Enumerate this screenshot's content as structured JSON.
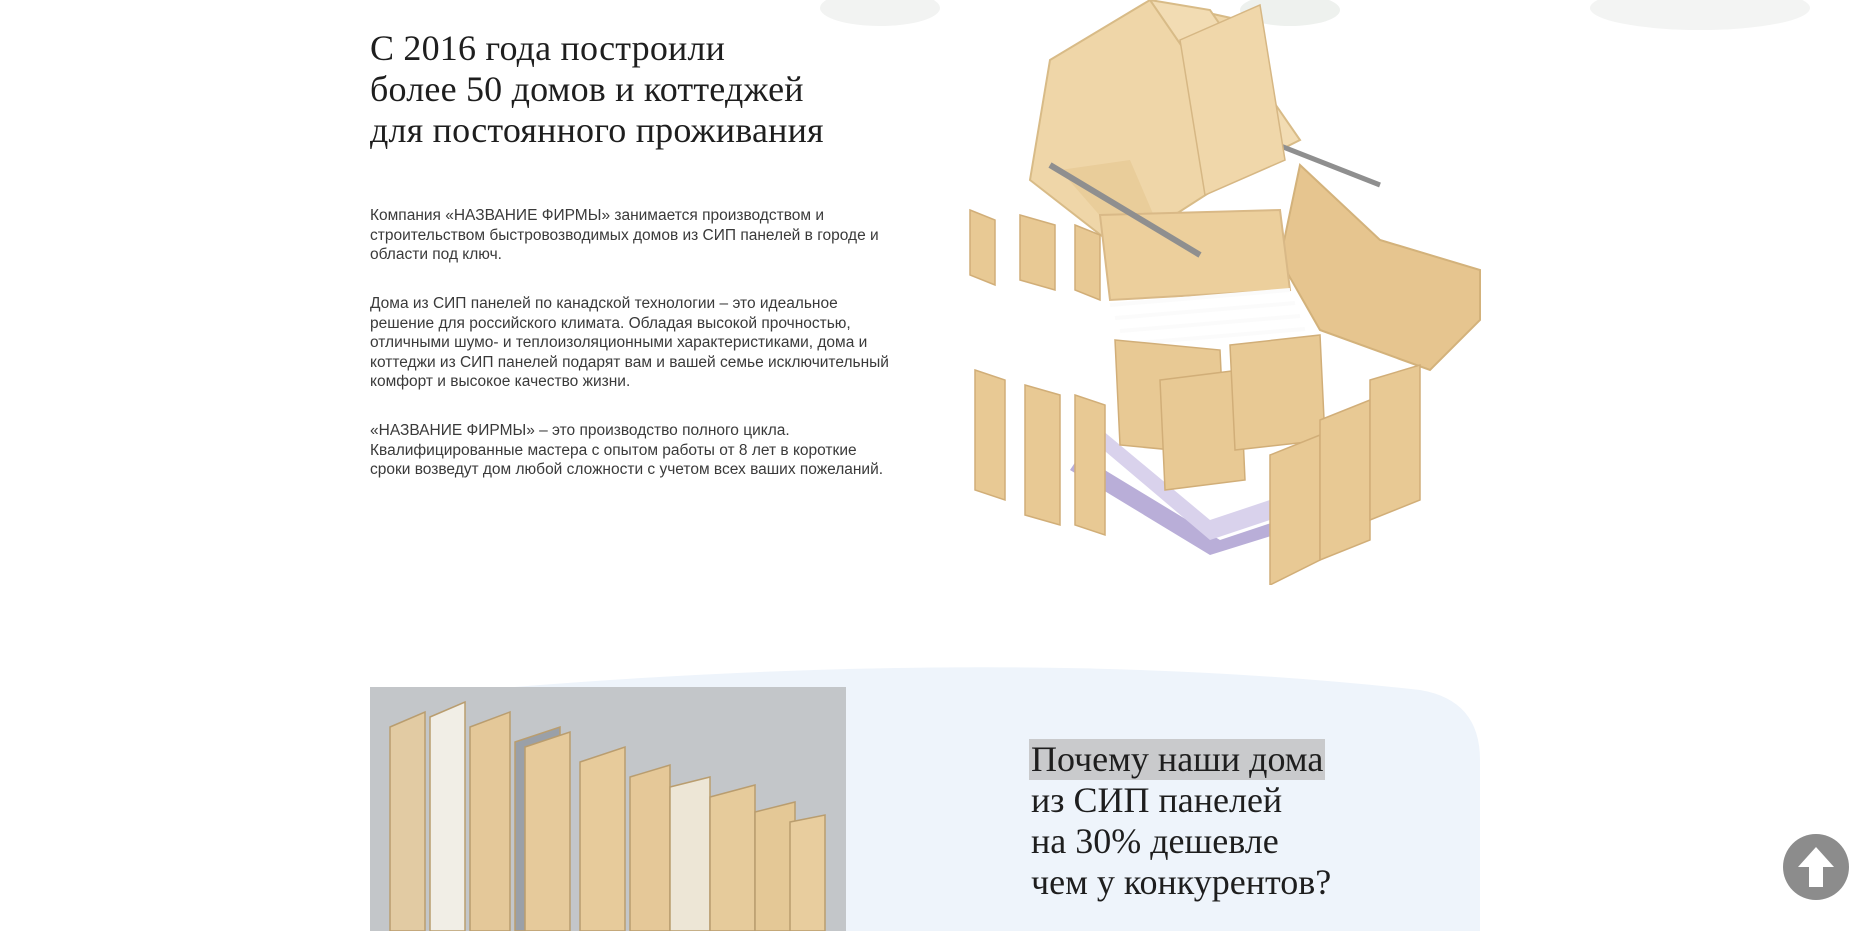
{
  "about": {
    "heading_lines": [
      "С 2016 года построили",
      "более 50 домов и коттеджей",
      "для постоянного проживания"
    ],
    "paragraph1": "Компания «НАЗВАНИЕ ФИРМЫ» занимается производством и строительством быстровозводимых домов из СИП панелей в городе и области под ключ.",
    "paragraph2": "Дома из СИП панелей по канадской технологии – это идеальное решение для российского климата. Обладая высокой прочностью, отличными шумо- и теплоизоляционными характеристиками, дома и коттеджи из СИП панелей подарят вам и вашей семье исключительный комфорт и высокое качество жизни.",
    "paragraph3": "«НАЗВАНИЕ ФИРМЫ» – это производство полного цикла. Квалифицированные мастера с опытом работы от 8 лет в короткие сроки возведут дом любой сложности с учетом всех ваших пожеланий."
  },
  "why": {
    "title_lines": [
      "Почему наши дома",
      "из СИП панелей",
      "на 30% дешевле",
      "чем у конкурентов?"
    ]
  },
  "icons": {
    "scroll_top": "arrow-up-icon"
  },
  "colors": {
    "osb": "#e6c896",
    "panel_bg": "#eef4fb",
    "panel_photo_bg": "#c3c6c9",
    "scroll_button": "#8c8c8c"
  }
}
